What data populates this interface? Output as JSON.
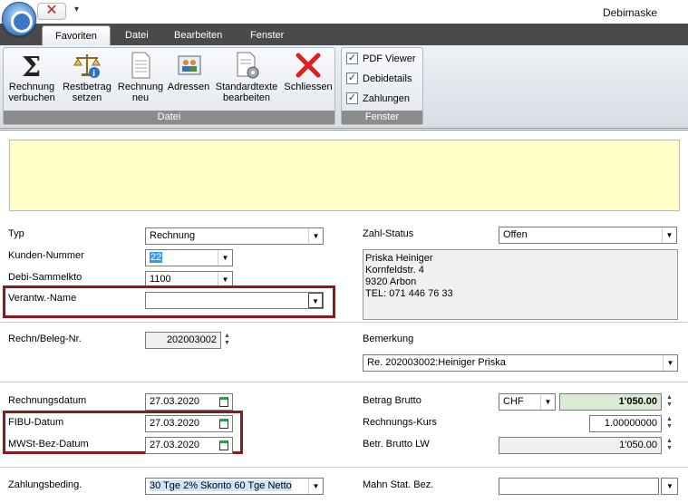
{
  "window": {
    "title": "Debimaske"
  },
  "tabs": [
    {
      "label": "Favoriten",
      "active": true
    },
    {
      "label": "Datei"
    },
    {
      "label": "Bearbeiten"
    },
    {
      "label": "Fenster"
    }
  ],
  "ribbon": {
    "groups": {
      "datei": "Datei",
      "fenster": "Fenster"
    },
    "buttons": {
      "rechnung_verbuchen": [
        "Rechnung",
        "verbuchen"
      ],
      "restbetrag_setzen": [
        "Restbetrag",
        "setzen"
      ],
      "rechnung_neu": [
        "Rechnung",
        "neu"
      ],
      "adressen": [
        "Adressen",
        ""
      ],
      "standardtexte": [
        "Standardtexte",
        "bearbeiten"
      ],
      "schliessen": [
        "Schliessen",
        ""
      ]
    },
    "checkboxes": {
      "pdf_viewer": "PDF Viewer",
      "debidetails": "Debidetails",
      "zahlungen": "Zahlungen"
    },
    "icons": [
      "sigma-icon",
      "scales-icon",
      "document-icon",
      "address-book-icon",
      "document-gear-icon",
      "red-x-icon"
    ]
  },
  "form": {
    "typ": {
      "label": "Typ",
      "value": "Rechnung"
    },
    "kunden_nummer": {
      "label": "Kunden-Nummer",
      "value": "22"
    },
    "debi_sammelkto": {
      "label": "Debi-Sammelkto",
      "value": "1100"
    },
    "verantw_name": {
      "label": "Verantw.-Name",
      "value": ""
    },
    "zahl_status": {
      "label": "Zahl-Status",
      "value": "Offen"
    },
    "address": {
      "line1": "Priska Heiniger",
      "line2": "Kornfeldstr. 4",
      "line3": "9320 Arbon",
      "line4": "TEL: 071 446 76 33"
    },
    "rechn_beleg_nr": {
      "label": "Rechn/Beleg-Nr.",
      "value": "202003002"
    },
    "bemerkung": {
      "label": "Bemerkung",
      "value": "Re.  202003002:Heiniger Priska"
    },
    "rechnungsdatum": {
      "label": "Rechnungsdatum",
      "value": "27.03.2020"
    },
    "fibu_datum": {
      "label": "FIBU-Datum",
      "value": "27.03.2020"
    },
    "mwst_bez_datum": {
      "label": "MWSt-Bez-Datum",
      "value": "27.03.2020"
    },
    "betrag_brutto": {
      "label": "Betrag Brutto",
      "currency": "CHF",
      "value": "1'050.00"
    },
    "rechnungs_kurs": {
      "label": "Rechnungs-Kurs",
      "value": "1.00000000"
    },
    "betr_brutto_lw": {
      "label": "Betr. Brutto LW",
      "value": "1'050.00"
    },
    "zahlungsbeding": {
      "label": "Zahlungsbeding.",
      "value": "30 Tge 2% Skonto 60 Tge Netto"
    },
    "mahn_stat_bez": {
      "label": "Mahn Stat. Bez.",
      "value": ""
    }
  },
  "colors": {
    "note_bg": "#ffffc8",
    "highlight_border": "#8b1b1b",
    "tabbar_bg": "#4a4a4a",
    "betrag_bg": "#d9ebd3"
  }
}
